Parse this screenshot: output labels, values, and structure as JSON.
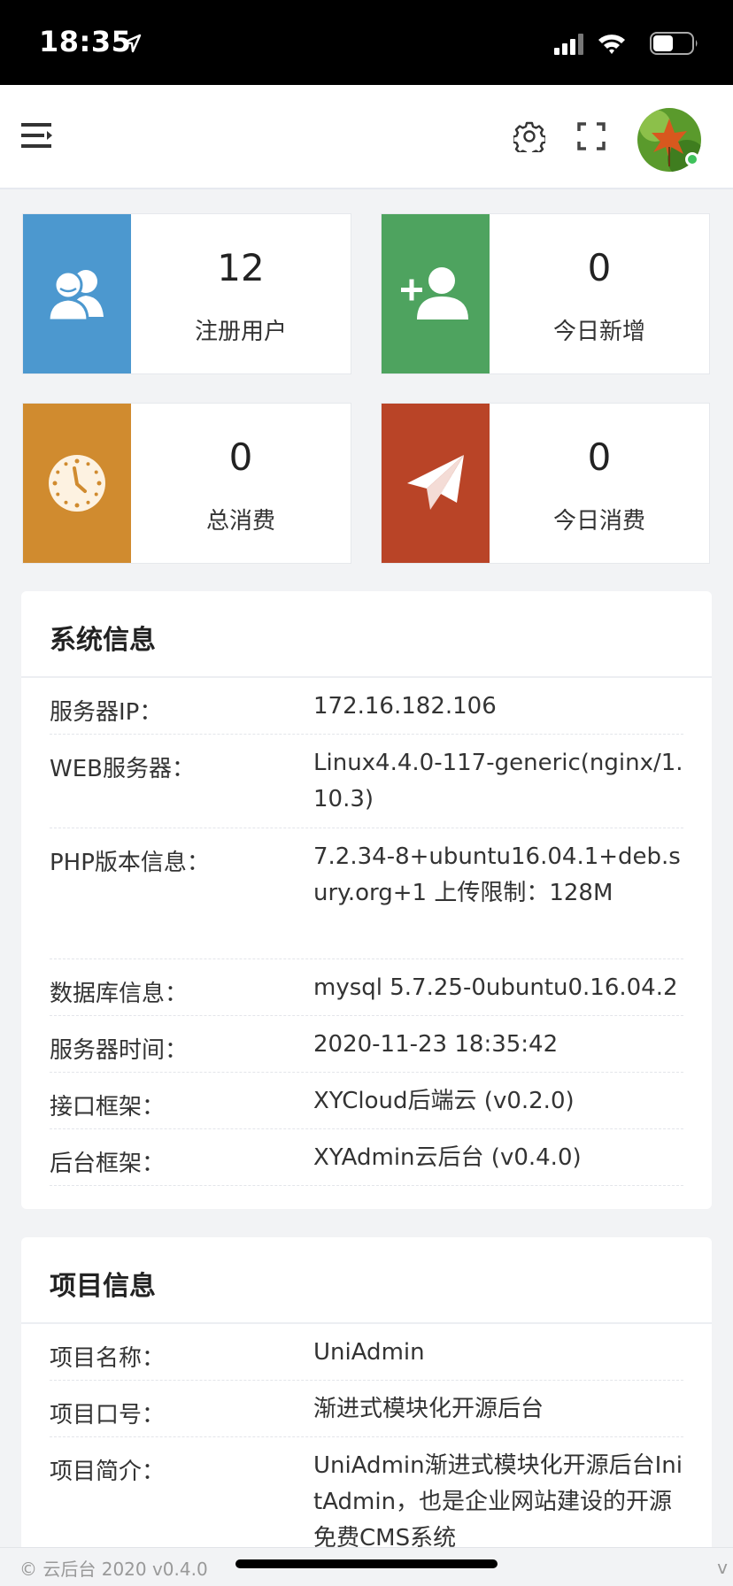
{
  "status_bar": {
    "time": "18:35"
  },
  "stats": [
    {
      "value": "12",
      "label": "注册用户",
      "color": "#4c98cf",
      "icon": "users-icon"
    },
    {
      "value": "0",
      "label": "今日新增",
      "color": "#4ea35f",
      "icon": "add-user-icon"
    },
    {
      "value": "0",
      "label": "总消费",
      "color": "#d08b2f",
      "icon": "clock-icon"
    },
    {
      "value": "0",
      "label": "今日消费",
      "color": "#b94427",
      "icon": "paper-plane-icon"
    }
  ],
  "system_info": {
    "title": "系统信息",
    "rows": [
      {
        "key": "服务器IP：",
        "value": "172.16.182.106"
      },
      {
        "key": "WEB服务器：",
        "value": "Linux4.4.0-117-generic(nginx/1.10.3)"
      },
      {
        "key": "PHP版本信息：",
        "value": "7.2.34-8+ubuntu16.04.1+deb.sury.org+1 上传限制：128M"
      },
      {
        "key": "数据库信息：",
        "value": "mysql 5.7.25-0ubuntu0.16.04.2"
      },
      {
        "key": "服务器时间：",
        "value": "2020-11-23 18:35:42"
      },
      {
        "key": "接口框架：",
        "value": "XYCloud后端云 (v0.2.0)"
      },
      {
        "key": "后台框架：",
        "value": "XYAdmin云后台 (v0.4.0)"
      }
    ]
  },
  "project_info": {
    "title": "项目信息",
    "rows": [
      {
        "key": "项目名称：",
        "value": "UniAdmin"
      },
      {
        "key": "项目口号：",
        "value": "渐进式模块化开源后台"
      },
      {
        "key": "项目简介：",
        "value": "UniAdmin渐进式模块化开源后台InitAdmin，也是企业网站建设的开源免费CMS系统"
      }
    ]
  },
  "footer": {
    "text": "© 云后台 2020 v0.4.0",
    "version_fragment": "v"
  }
}
